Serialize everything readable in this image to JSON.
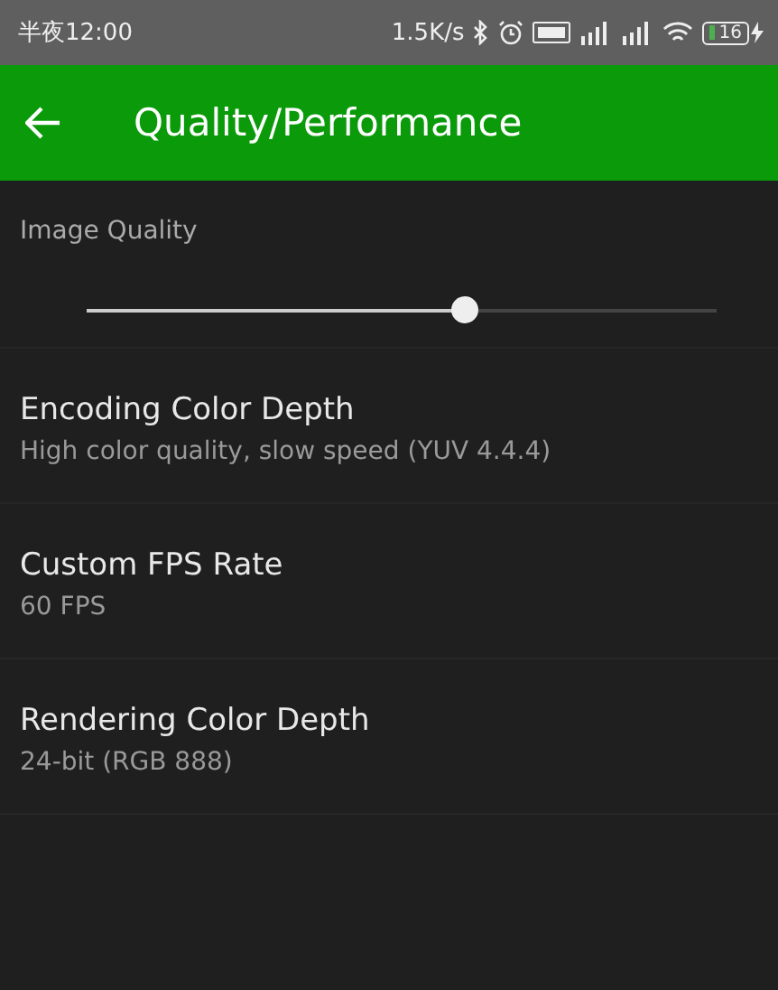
{
  "status_bar": {
    "time": "半夜12:00",
    "speed": "1.5K/s",
    "battery": "16"
  },
  "app_bar": {
    "title": "Quality/Performance"
  },
  "image_quality": {
    "label": "Image Quality",
    "level": 0.6
  },
  "settings": [
    {
      "title": "Encoding Color Depth",
      "summary": "High color quality, slow speed (YUV 4.4.4)"
    },
    {
      "title": "Custom FPS Rate",
      "summary": "60 FPS"
    },
    {
      "title": "Rendering Color Depth",
      "summary": "24-bit (RGB 888)"
    }
  ]
}
